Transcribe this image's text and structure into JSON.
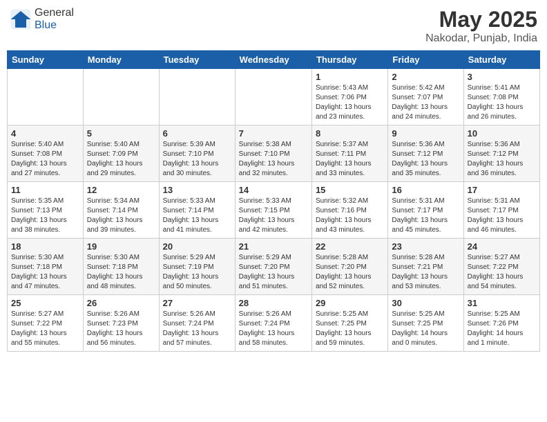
{
  "header": {
    "logo_general": "General",
    "logo_blue": "Blue",
    "title": "May 2025",
    "subtitle": "Nakodar, Punjab, India"
  },
  "calendar": {
    "days_of_week": [
      "Sunday",
      "Monday",
      "Tuesday",
      "Wednesday",
      "Thursday",
      "Friday",
      "Saturday"
    ],
    "weeks": [
      {
        "days": [
          {
            "num": "",
            "info": ""
          },
          {
            "num": "",
            "info": ""
          },
          {
            "num": "",
            "info": ""
          },
          {
            "num": "",
            "info": ""
          },
          {
            "num": "1",
            "info": "Sunrise: 5:43 AM\nSunset: 7:06 PM\nDaylight: 13 hours\nand 23 minutes."
          },
          {
            "num": "2",
            "info": "Sunrise: 5:42 AM\nSunset: 7:07 PM\nDaylight: 13 hours\nand 24 minutes."
          },
          {
            "num": "3",
            "info": "Sunrise: 5:41 AM\nSunset: 7:08 PM\nDaylight: 13 hours\nand 26 minutes."
          }
        ]
      },
      {
        "days": [
          {
            "num": "4",
            "info": "Sunrise: 5:40 AM\nSunset: 7:08 PM\nDaylight: 13 hours\nand 27 minutes."
          },
          {
            "num": "5",
            "info": "Sunrise: 5:40 AM\nSunset: 7:09 PM\nDaylight: 13 hours\nand 29 minutes."
          },
          {
            "num": "6",
            "info": "Sunrise: 5:39 AM\nSunset: 7:10 PM\nDaylight: 13 hours\nand 30 minutes."
          },
          {
            "num": "7",
            "info": "Sunrise: 5:38 AM\nSunset: 7:10 PM\nDaylight: 13 hours\nand 32 minutes."
          },
          {
            "num": "8",
            "info": "Sunrise: 5:37 AM\nSunset: 7:11 PM\nDaylight: 13 hours\nand 33 minutes."
          },
          {
            "num": "9",
            "info": "Sunrise: 5:36 AM\nSunset: 7:12 PM\nDaylight: 13 hours\nand 35 minutes."
          },
          {
            "num": "10",
            "info": "Sunrise: 5:36 AM\nSunset: 7:12 PM\nDaylight: 13 hours\nand 36 minutes."
          }
        ]
      },
      {
        "days": [
          {
            "num": "11",
            "info": "Sunrise: 5:35 AM\nSunset: 7:13 PM\nDaylight: 13 hours\nand 38 minutes."
          },
          {
            "num": "12",
            "info": "Sunrise: 5:34 AM\nSunset: 7:14 PM\nDaylight: 13 hours\nand 39 minutes."
          },
          {
            "num": "13",
            "info": "Sunrise: 5:33 AM\nSunset: 7:14 PM\nDaylight: 13 hours\nand 41 minutes."
          },
          {
            "num": "14",
            "info": "Sunrise: 5:33 AM\nSunset: 7:15 PM\nDaylight: 13 hours\nand 42 minutes."
          },
          {
            "num": "15",
            "info": "Sunrise: 5:32 AM\nSunset: 7:16 PM\nDaylight: 13 hours\nand 43 minutes."
          },
          {
            "num": "16",
            "info": "Sunrise: 5:31 AM\nSunset: 7:17 PM\nDaylight: 13 hours\nand 45 minutes."
          },
          {
            "num": "17",
            "info": "Sunrise: 5:31 AM\nSunset: 7:17 PM\nDaylight: 13 hours\nand 46 minutes."
          }
        ]
      },
      {
        "days": [
          {
            "num": "18",
            "info": "Sunrise: 5:30 AM\nSunset: 7:18 PM\nDaylight: 13 hours\nand 47 minutes."
          },
          {
            "num": "19",
            "info": "Sunrise: 5:30 AM\nSunset: 7:18 PM\nDaylight: 13 hours\nand 48 minutes."
          },
          {
            "num": "20",
            "info": "Sunrise: 5:29 AM\nSunset: 7:19 PM\nDaylight: 13 hours\nand 50 minutes."
          },
          {
            "num": "21",
            "info": "Sunrise: 5:29 AM\nSunset: 7:20 PM\nDaylight: 13 hours\nand 51 minutes."
          },
          {
            "num": "22",
            "info": "Sunrise: 5:28 AM\nSunset: 7:20 PM\nDaylight: 13 hours\nand 52 minutes."
          },
          {
            "num": "23",
            "info": "Sunrise: 5:28 AM\nSunset: 7:21 PM\nDaylight: 13 hours\nand 53 minutes."
          },
          {
            "num": "24",
            "info": "Sunrise: 5:27 AM\nSunset: 7:22 PM\nDaylight: 13 hours\nand 54 minutes."
          }
        ]
      },
      {
        "days": [
          {
            "num": "25",
            "info": "Sunrise: 5:27 AM\nSunset: 7:22 PM\nDaylight: 13 hours\nand 55 minutes."
          },
          {
            "num": "26",
            "info": "Sunrise: 5:26 AM\nSunset: 7:23 PM\nDaylight: 13 hours\nand 56 minutes."
          },
          {
            "num": "27",
            "info": "Sunrise: 5:26 AM\nSunset: 7:24 PM\nDaylight: 13 hours\nand 57 minutes."
          },
          {
            "num": "28",
            "info": "Sunrise: 5:26 AM\nSunset: 7:24 PM\nDaylight: 13 hours\nand 58 minutes."
          },
          {
            "num": "29",
            "info": "Sunrise: 5:25 AM\nSunset: 7:25 PM\nDaylight: 13 hours\nand 59 minutes."
          },
          {
            "num": "30",
            "info": "Sunrise: 5:25 AM\nSunset: 7:25 PM\nDaylight: 14 hours\nand 0 minutes."
          },
          {
            "num": "31",
            "info": "Sunrise: 5:25 AM\nSunset: 7:26 PM\nDaylight: 14 hours\nand 1 minute."
          }
        ]
      }
    ]
  }
}
